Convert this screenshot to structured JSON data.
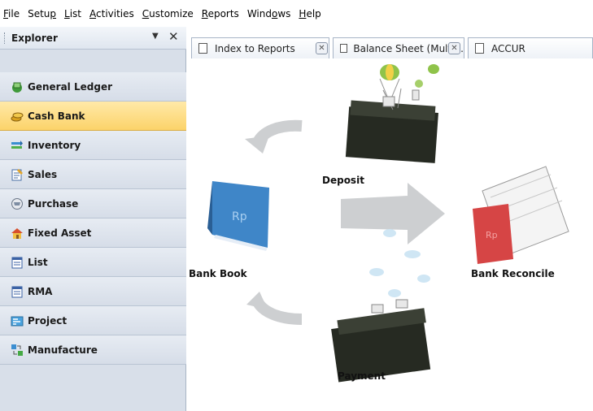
{
  "menu": {
    "items": [
      {
        "accel": "F",
        "rest": "ile"
      },
      {
        "pre": "Setu",
        "accel": "p",
        "rest": ""
      },
      {
        "accel": "L",
        "rest": "ist"
      },
      {
        "accel": "A",
        "rest": "ctivities"
      },
      {
        "accel": "C",
        "rest": "ustomize"
      },
      {
        "accel": "R",
        "rest": "eports"
      },
      {
        "pre": "Wind",
        "accel": "o",
        "rest": "ws"
      },
      {
        "accel": "H",
        "rest": "elp"
      }
    ]
  },
  "explorer": {
    "title": "Explorer",
    "pin_glyph": "▼",
    "close_glyph": "✕"
  },
  "modules": [
    {
      "label": "General Ledger",
      "icon": "general-ledger-icon"
    },
    {
      "label": "Cash Bank",
      "icon": "cash-bank-icon",
      "active": true
    },
    {
      "label": "Inventory",
      "icon": "inventory-icon"
    },
    {
      "label": "Sales",
      "icon": "sales-icon"
    },
    {
      "label": "Purchase",
      "icon": "purchase-icon"
    },
    {
      "label": "Fixed Asset",
      "icon": "fixed-asset-icon"
    },
    {
      "label": "List",
      "icon": "list-icon"
    },
    {
      "label": "RMA",
      "icon": "rma-icon"
    },
    {
      "label": "Project",
      "icon": "project-icon"
    },
    {
      "label": "Manufacture",
      "icon": "manufacture-icon"
    }
  ],
  "tabs": [
    {
      "label": "Index to Reports",
      "icon": "document-icon"
    },
    {
      "label": "Balance Sheet (Multi...",
      "icon": "report-icon"
    },
    {
      "label": "ACCUR",
      "icon": "document-icon"
    }
  ],
  "diagram": {
    "deposit": "Deposit",
    "bank_book": "Bank Book",
    "bank_reconcile": "Bank Reconcile",
    "payment": "Payment",
    "book_text": "Rp",
    "reconcile_text": "Rp"
  },
  "colors": {
    "active_module": "#fcd36a",
    "sidebar_bg": "#d8dfe9",
    "arrow_gray": "#c9cbcd"
  }
}
